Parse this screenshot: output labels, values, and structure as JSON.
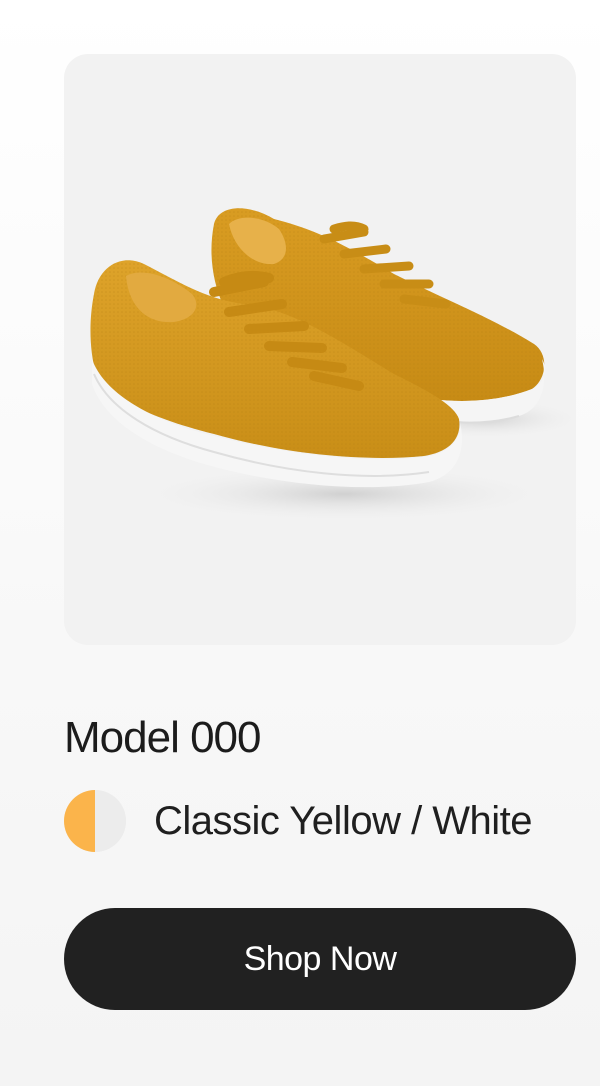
{
  "product": {
    "title": "Model 000",
    "image_icon": "yellow-knit-sneakers-pair",
    "color": {
      "name": "Classic Yellow / White",
      "swatch_primary": "#fbb44b",
      "swatch_secondary": "#ececec"
    }
  },
  "cta": {
    "label": "Shop Now",
    "background": "#212121",
    "text_color": "#ffffff"
  },
  "colors": {
    "card_background": "#f2f2f2",
    "shoe_knit": "#d69a20",
    "sole": "#f4f4f4"
  }
}
